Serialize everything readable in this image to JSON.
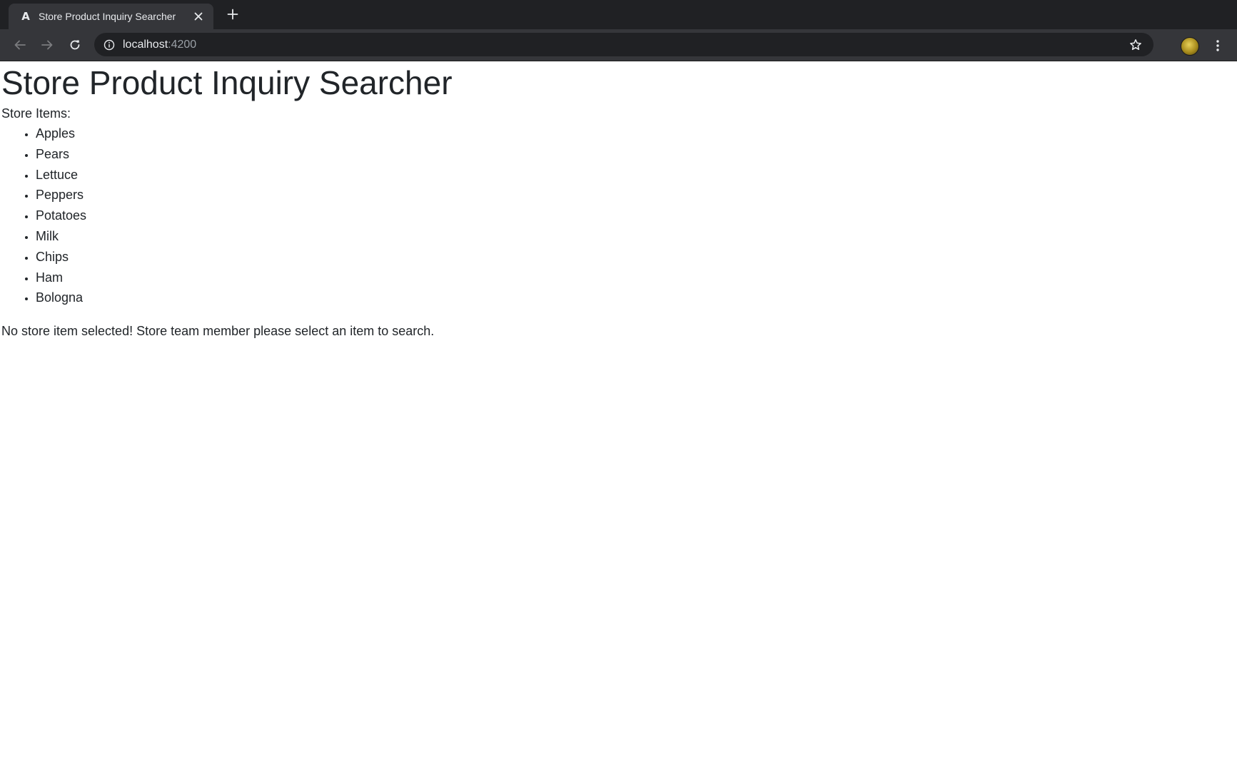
{
  "browser": {
    "tab": {
      "favicon": "angular-icon",
      "title": "Store Product Inquiry Searcher",
      "close_icon": "close-icon"
    },
    "new_tab_icon": "plus-icon",
    "nav": {
      "back_icon": "arrow-left-icon",
      "forward_icon": "arrow-right-icon",
      "reload_icon": "reload-icon"
    },
    "omnibox": {
      "info_icon": "info-icon",
      "host": "localhost",
      "port": ":4200",
      "bookmark_icon": "star-icon"
    },
    "profile_icon": "avatar",
    "menu_icon": "kebab-menu-icon",
    "colors": {
      "tabstrip": "#202124",
      "toolbar": "#35363a",
      "omnibox": "#202124"
    }
  },
  "page": {
    "title": "Store Product Inquiry Searcher",
    "items_label": "Store Items:",
    "items": [
      "Apples",
      "Pears",
      "Lettuce",
      "Peppers",
      "Potatoes",
      "Milk",
      "Chips",
      "Ham",
      "Bologna"
    ],
    "message": "No store item selected! Store team member please select an item to search.",
    "text_color": "#212529"
  }
}
